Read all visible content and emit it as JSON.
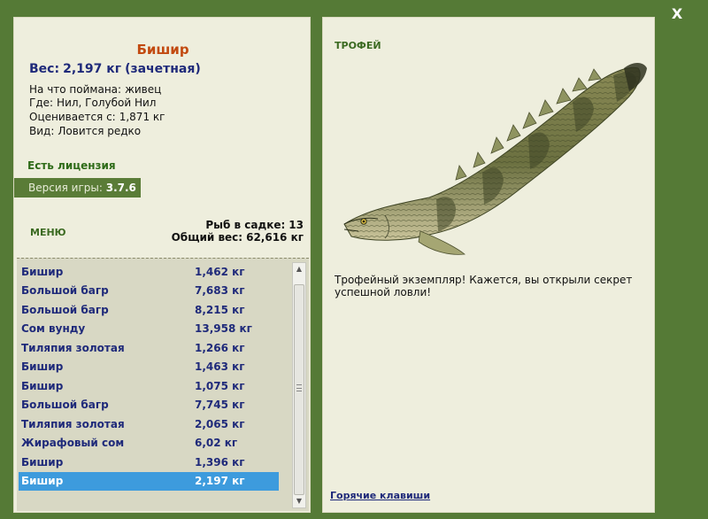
{
  "window": {
    "close_label": "X"
  },
  "catch": {
    "name": "Бишир",
    "weight_label": "Вес:",
    "weight_value": "2,197 кг",
    "weight_note": "(зачетная)",
    "bait_label": "На что поймана:",
    "bait_value": "живец",
    "location_label": "Где:",
    "location_value": "Нил, Голубой Нил",
    "threshold_label": "Оценивается с:",
    "threshold_value": "1,871 кг",
    "rarity_label": "Вид:",
    "rarity_value": "Ловится редко"
  },
  "license_text": "Есть лицензия",
  "version": {
    "label": "Версия игры:",
    "value": "3.7.6"
  },
  "menu_label": "МЕНЮ",
  "totals": {
    "count_label": "Рыб в садке:",
    "count_value": "13",
    "weight_label": "Общий вес:",
    "weight_value": "62,616 кг"
  },
  "fish_list": [
    {
      "name": "Бишир",
      "weight": "1,462 кг"
    },
    {
      "name": "Большой багр",
      "weight": "7,683 кг"
    },
    {
      "name": "Большой багр",
      "weight": "8,215 кг"
    },
    {
      "name": "Сом вунду",
      "weight": "13,958 кг"
    },
    {
      "name": "Тиляпия золотая",
      "weight": "1,266 кг"
    },
    {
      "name": "Бишир",
      "weight": "1,463 кг"
    },
    {
      "name": "Бишир",
      "weight": "1,075 кг"
    },
    {
      "name": "Большой багр",
      "weight": "7,745 кг"
    },
    {
      "name": "Тиляпия золотая",
      "weight": "2,065 кг"
    },
    {
      "name": "Жирафовый сом",
      "weight": "6,02 кг"
    },
    {
      "name": "Бишир",
      "weight": "1,396 кг"
    },
    {
      "name": "Бишир",
      "weight": "2,197 кг"
    }
  ],
  "selected_index": 11,
  "trophy": {
    "label": "ТРОФЕЙ",
    "message": "Трофейный экземпляр! Кажется, вы открыли секрет успешной ловли!"
  },
  "hotkeys_label": "Горячие клавиши",
  "colors": {
    "background": "#557a36",
    "panel": "#eeeedd",
    "list_background": "#d8d8c4",
    "selection": "#3d9bdd",
    "fish_name": "#c24a10",
    "list_text": "#1f2a7a",
    "accent_green": "#3b6a21"
  },
  "icons": {
    "close": "close-icon",
    "fish": "bichir-fish-image"
  }
}
